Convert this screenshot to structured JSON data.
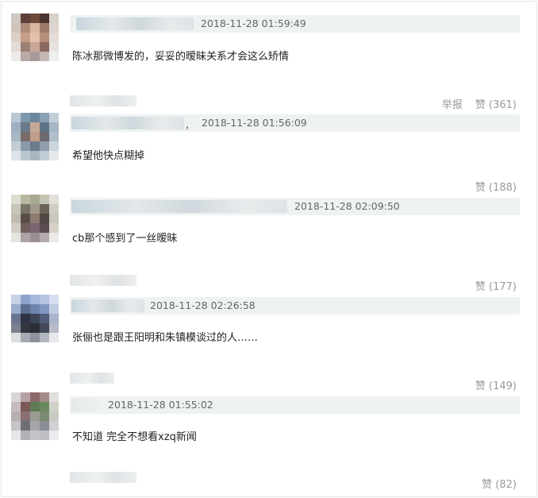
{
  "comments": [
    {
      "timestamp": "2018-11-28 01:59:49",
      "text": "陈冰那微博发的，妥妥的暧昧关系才会这么矫情",
      "report": "举报",
      "like": "赞 (361)"
    },
    {
      "timestamp": "2018-11-28 01:56:09",
      "separator": "，",
      "text": "希望他快点糊掉",
      "like": "赞 (188)"
    },
    {
      "timestamp": "2018-11-28 02:09:50",
      "text": "cb那个感到了一丝暧昧",
      "like": "赞 (177)"
    },
    {
      "timestamp": "2018-11-28 02:26:58",
      "text": "张俪也是跟王阳明和朱镇模谈过的人……",
      "like": "赞 (149)"
    },
    {
      "timestamp": "2018-11-28 01:55:02",
      "text": "不知道 完全不想看xzq新闻",
      "like": "赞 (82)"
    }
  ]
}
